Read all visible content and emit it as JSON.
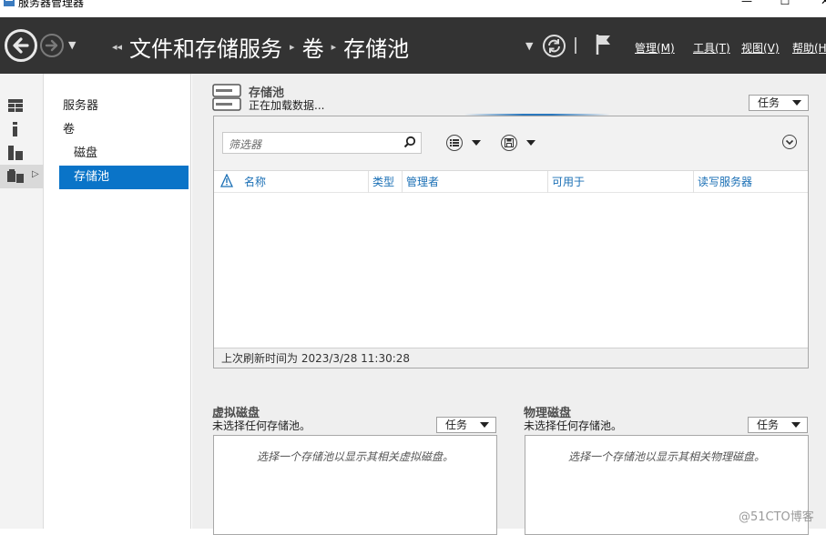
{
  "window": {
    "title": "服务器管理器",
    "minimize": "—",
    "maximize": "☐",
    "close": "✕"
  },
  "header": {
    "breadcrumb": [
      "文件和存储服务",
      "卷",
      "存储池"
    ],
    "breadcrumb_prefix": "◂◂",
    "menus": [
      "管理(M)",
      "工具(T)",
      "视图(V)",
      "帮助(H)"
    ]
  },
  "nav": {
    "items": [
      {
        "label": "服务器"
      },
      {
        "label": "卷"
      },
      {
        "label": "磁盘"
      },
      {
        "label": "存储池"
      }
    ]
  },
  "storage_pools": {
    "title": "存储池",
    "subtitle": "正在加载数据...",
    "tasks_label": "任务",
    "filter_placeholder": "筛选器",
    "columns": [
      "名称",
      "类型",
      "管理者",
      "可用于",
      "读写服务器"
    ],
    "status": "上次刷新时间为 2023/3/28 11:30:28"
  },
  "virtual_disks": {
    "title": "虚拟磁盘",
    "subtitle": "未选择任何存储池。",
    "tasks_label": "任务",
    "message": "选择一个存储池以显示其相关虚拟磁盘。"
  },
  "physical_disks": {
    "title": "物理磁盘",
    "subtitle": "未选择任何存储池。",
    "tasks_label": "任务",
    "message": "选择一个存储池以显示其相关物理磁盘。"
  },
  "watermark": "@51CTO博客",
  "colors": {
    "header_bg": "#333333",
    "selection": "#0a74c8",
    "link_blue": "#1a6fb5"
  }
}
